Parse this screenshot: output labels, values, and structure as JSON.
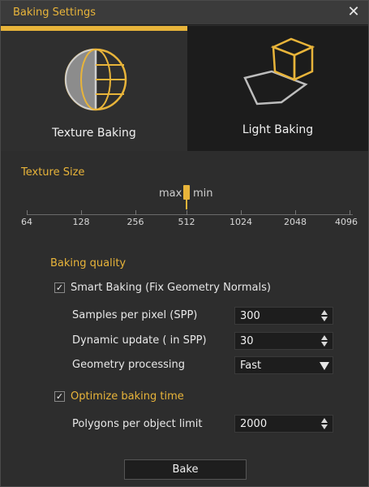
{
  "window": {
    "title": "Baking Settings"
  },
  "tabs": [
    {
      "label": "Texture Baking",
      "icon": "globe-texture-icon",
      "active": true
    },
    {
      "label": "Light Baking",
      "icon": "cube-light-icon",
      "active": false
    }
  ],
  "texture_size": {
    "label": "Texture Size",
    "max_label": "max",
    "min_label": "min",
    "ticks": [
      "64",
      "128",
      "256",
      "512",
      "1024",
      "2048",
      "4096"
    ],
    "selected": "512"
  },
  "quality": {
    "heading": "Baking quality",
    "smart_baking": {
      "label": "Smart Baking (Fix Geometry Normals)",
      "checked": true,
      "mark": "✓"
    },
    "spp": {
      "label": "Samples per pixel (SPP)",
      "value": "300"
    },
    "dynamic_update": {
      "label": "Dynamic update ( in SPP)",
      "value": "30"
    },
    "geometry": {
      "label": "Geometry processing",
      "value": "Fast"
    },
    "optimize": {
      "label": "Optimize baking time",
      "checked": true,
      "mark": "✓"
    },
    "polygons": {
      "label": "Polygons per object limit",
      "value": "2000"
    }
  },
  "actions": {
    "bake_label": "Bake"
  },
  "colors": {
    "accent": "#e8b43a",
    "background": "#2d2d2d",
    "tab_inactive": "#1c1c1c"
  }
}
